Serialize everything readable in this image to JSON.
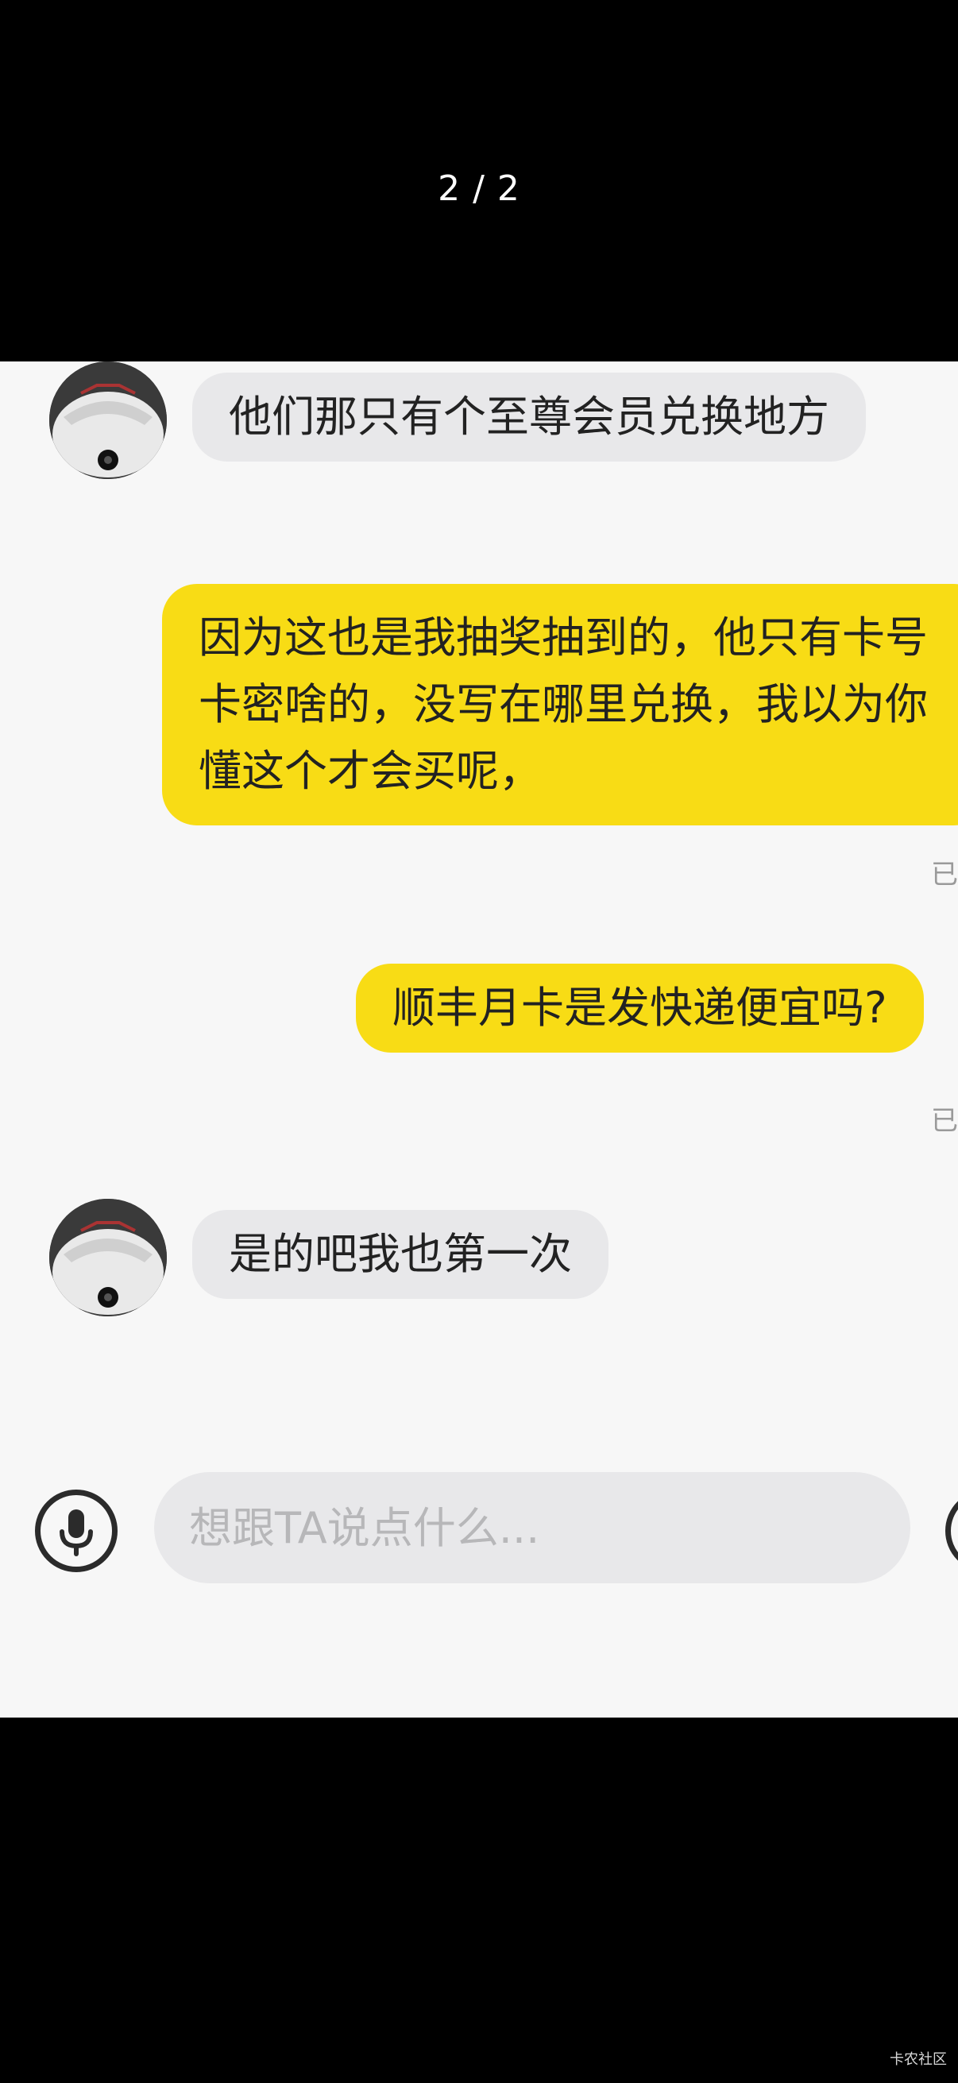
{
  "viewer": {
    "page_counter": "2 / 2",
    "watermark": "卡农社区"
  },
  "chat": {
    "messages": [
      {
        "side": "received",
        "text": "他们那只有个至尊会员兑换地方"
      },
      {
        "side": "sent",
        "text": "因为这也是我抽奖抽到的，他只有卡号卡密啥的，没写在哪里兑换，我以为你懂这个才会买呢，",
        "status": "已"
      },
      {
        "side": "sent",
        "text": "顺丰月卡是发快递便宜吗?",
        "status": "已"
      },
      {
        "side": "received",
        "text": "是的吧我也第一次"
      }
    ]
  },
  "input_bar": {
    "placeholder": "想跟TA说点什么..."
  },
  "colors": {
    "sent_bubble": "#f8dc15",
    "received_bubble": "#e8e8ea",
    "chat_background": "#f7f7f7"
  },
  "icons": {
    "voice": "microphone-icon",
    "avatar": "contact-avatar"
  }
}
